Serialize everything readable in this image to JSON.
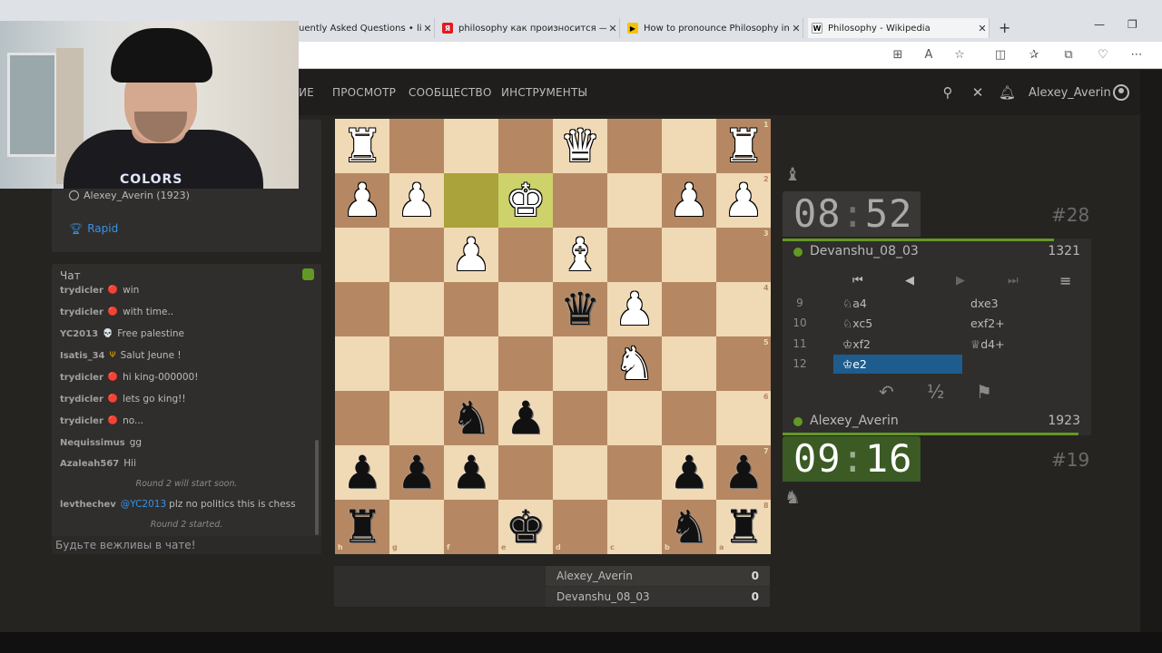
{
  "browser": {
    "tabs": [
      {
        "title": "uently Asked Questions • lich",
        "favicon": "",
        "fav_color": "#ffffff"
      },
      {
        "title": "philosophy как произносится — ",
        "favicon": "Я",
        "fav_color": "#e01b22"
      },
      {
        "title": "How to pronounce Philosophy in",
        "favicon": "▶",
        "fav_color": "#f5c400"
      },
      {
        "title": "Philosophy - Wikipedia",
        "favicon": "W",
        "fav_color": "#ffffff"
      }
    ],
    "close_glyph": "✕",
    "new_tab": "+",
    "minimize": "—",
    "restore": "❐"
  },
  "header": {
    "nav": [
      "ИЕ",
      "ПРОСМОТР",
      "СООБЩЕСТВО",
      "ИНСТРУМЕНТЫ"
    ],
    "username": "Alexey_Averin"
  },
  "game_info": {
    "player": "Alexey_Averin (1923)",
    "mode": "Rapid"
  },
  "chat": {
    "title": "Чат",
    "lines": [
      {
        "user": "trydicler",
        "text": "win"
      },
      {
        "user": "trydicler",
        "text": "with time.."
      },
      {
        "user": "YC2013",
        "text": "Free palestine"
      },
      {
        "user": "Isatis_34",
        "text": "Salut Jeune !"
      },
      {
        "user": "trydicler",
        "text": "hi king-000000!"
      },
      {
        "user": "trydicler",
        "text": "lets go king!!"
      },
      {
        "user": "trydicler",
        "text": "no..."
      },
      {
        "user": "Nequissimus",
        "text": "gg"
      },
      {
        "user": "Azaleah567",
        "text": "Hii"
      }
    ],
    "system1": "Round 2 will start soon.",
    "last_user": "levthechev",
    "last_mention": "@YC2013",
    "last_text": "plz no politics this is chess",
    "system2": "Round 2 started.",
    "input_placeholder": "Будьте вежливы в чате!"
  },
  "board": {
    "files_bottom": [
      "h",
      "g",
      "f",
      "e",
      "d",
      "c",
      "b",
      "a"
    ],
    "ranks_right": [
      "1",
      "2",
      "3",
      "4",
      "5",
      "6",
      "7",
      "8"
    ],
    "pieces": [
      {
        "row": 0,
        "col": 0,
        "glyph": "♜",
        "color": "w"
      },
      {
        "row": 0,
        "col": 4,
        "glyph": "♛",
        "color": "w"
      },
      {
        "row": 0,
        "col": 7,
        "glyph": "♜",
        "color": "w"
      },
      {
        "row": 1,
        "col": 0,
        "glyph": "♟",
        "color": "w"
      },
      {
        "row": 1,
        "col": 1,
        "glyph": "♟",
        "color": "w"
      },
      {
        "row": 1,
        "col": 3,
        "glyph": "♚",
        "color": "w"
      },
      {
        "row": 1,
        "col": 6,
        "glyph": "♟",
        "color": "w"
      },
      {
        "row": 1,
        "col": 7,
        "glyph": "♟",
        "color": "w"
      },
      {
        "row": 2,
        "col": 2,
        "glyph": "♟",
        "color": "w"
      },
      {
        "row": 2,
        "col": 4,
        "glyph": "♝",
        "color": "w"
      },
      {
        "row": 3,
        "col": 4,
        "glyph": "♛",
        "color": "b"
      },
      {
        "row": 3,
        "col": 5,
        "glyph": "♟",
        "color": "w"
      },
      {
        "row": 4,
        "col": 5,
        "glyph": "♞",
        "color": "w"
      },
      {
        "row": 5,
        "col": 2,
        "glyph": "♞",
        "color": "b"
      },
      {
        "row": 5,
        "col": 3,
        "glyph": "♟",
        "color": "b"
      },
      {
        "row": 6,
        "col": 0,
        "glyph": "♟",
        "color": "b"
      },
      {
        "row": 6,
        "col": 1,
        "glyph": "♟",
        "color": "b"
      },
      {
        "row": 6,
        "col": 2,
        "glyph": "♟",
        "color": "b"
      },
      {
        "row": 6,
        "col": 6,
        "glyph": "♟",
        "color": "b"
      },
      {
        "row": 6,
        "col": 7,
        "glyph": "♟",
        "color": "b"
      },
      {
        "row": 7,
        "col": 0,
        "glyph": "♜",
        "color": "b"
      },
      {
        "row": 7,
        "col": 3,
        "glyph": "♚",
        "color": "b"
      },
      {
        "row": 7,
        "col": 6,
        "glyph": "♞",
        "color": "b"
      },
      {
        "row": 7,
        "col": 7,
        "glyph": "♜",
        "color": "b"
      }
    ],
    "highlights": [
      {
        "row": 1,
        "col": 2
      },
      {
        "row": 1,
        "col": 3
      }
    ]
  },
  "standings": [
    {
      "name": "Alexey_Averin",
      "score": "0"
    },
    {
      "name": "Devanshu_08_03",
      "score": "0"
    }
  ],
  "opponent": {
    "clock_mm": "08",
    "clock_ss": "52",
    "rank": "#28",
    "name": "Devanshu_08_03",
    "rating": "1321",
    "time_fraction": 0.88
  },
  "me": {
    "clock_mm": "09",
    "clock_ss": "16",
    "rank": "#19",
    "name": "Alexey_Averin",
    "rating": "1923",
    "time_fraction": 0.96
  },
  "moves": [
    {
      "n": "9",
      "w": "♘a4",
      "b": "dxe3"
    },
    {
      "n": "10",
      "w": "♘xc5",
      "b": "exf2+"
    },
    {
      "n": "11",
      "w": "♔xf2",
      "b": "♕d4+"
    },
    {
      "n": "12",
      "w": "♔e2",
      "b": ""
    }
  ],
  "controls": {
    "first": "⏮",
    "prev": "◀",
    "next": "▶",
    "last": "⏭",
    "menu": "≡",
    "takeback": "↶",
    "draw": "½",
    "resign": "⚑"
  },
  "webcam": {
    "shirt_text": "COLORS"
  }
}
